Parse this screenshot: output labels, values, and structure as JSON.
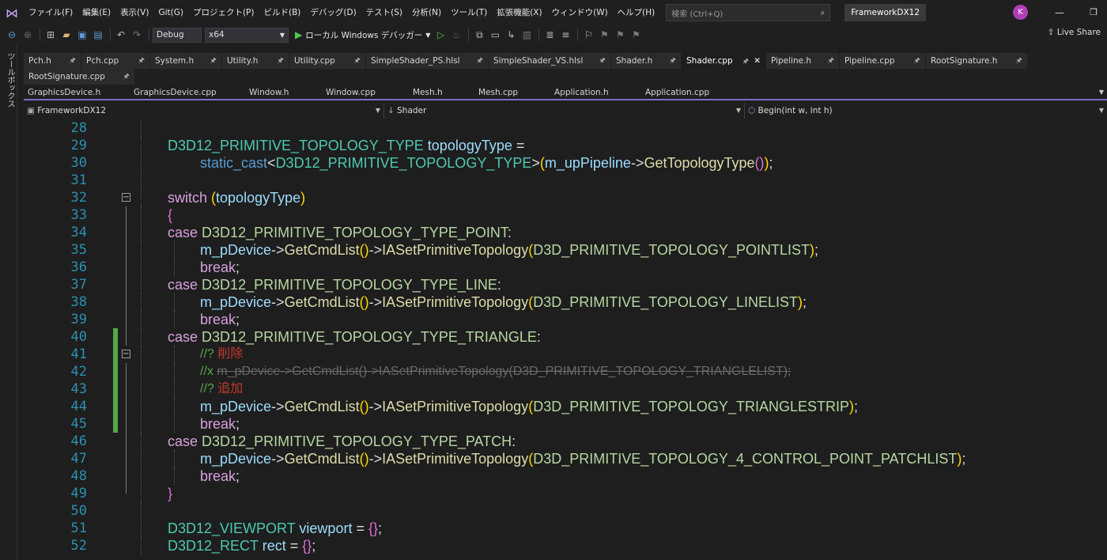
{
  "menubar": {
    "items": [
      "ファイル(F)",
      "編集(E)",
      "表示(V)",
      "Git(G)",
      "プロジェクト(P)",
      "ビルド(B)",
      "デバッグ(D)",
      "テスト(S)",
      "分析(N)",
      "ツール(T)",
      "拡張機能(X)",
      "ウィンドウ(W)",
      "ヘルプ(H)"
    ],
    "search_placeholder": "検索 (Ctrl+Q)",
    "solution_name": "FrameworkDX12",
    "avatar_initial": "K"
  },
  "toolbar": {
    "configuration": "Debug",
    "platform": "x64",
    "run_label": "ローカル Windows デバッガー",
    "live_share": "Live Share"
  },
  "toolbox": {
    "label": "ツールボックス"
  },
  "tabs_row1": [
    {
      "label": "Pch.h",
      "active": false
    },
    {
      "label": "Pch.cpp",
      "active": false
    },
    {
      "label": "System.h",
      "active": false
    },
    {
      "label": "Utility.h",
      "active": false
    },
    {
      "label": "Utility.cpp",
      "active": false
    },
    {
      "label": "SimpleShader_PS.hlsl",
      "active": false
    },
    {
      "label": "SimpleShader_VS.hlsl",
      "active": false
    },
    {
      "label": "Shader.h",
      "active": false
    },
    {
      "label": "Shader.cpp",
      "active": true
    },
    {
      "label": "Pipeline.h",
      "active": false
    },
    {
      "label": "Pipeline.cpp",
      "active": false
    },
    {
      "label": "RootSignature.h",
      "active": false
    }
  ],
  "tabs_row2": [
    {
      "label": "RootSignature.cpp",
      "active": false
    }
  ],
  "tabs_row3": [
    "GraphicsDevice.h",
    "GraphicsDevice.cpp",
    "Window.h",
    "Window.cpp",
    "Mesh.h",
    "Mesh.cpp",
    "Application.h",
    "Application.cpp"
  ],
  "navbar": {
    "project": "FrameworkDX12",
    "scope": "Shader",
    "member": "Begin(int w, int h)"
  },
  "editor": {
    "line_numbers": [
      "28",
      "29",
      "30",
      "31",
      "32",
      "33",
      "34",
      "35",
      "36",
      "37",
      "38",
      "39",
      "40",
      "41",
      "42",
      "43",
      "44",
      "45",
      "46",
      "47",
      "48",
      "49",
      "50",
      "51",
      "52"
    ],
    "code": {
      "l29_type": "D3D12_PRIMITIVE_TOPOLOGY_TYPE",
      "l29_var": "topologyType",
      "l30_cast": "static_cast",
      "l30_type": "D3D12_PRIMITIVE_TOPOLOGY_TYPE",
      "l30_member": "m_upPipeline",
      "l30_fn": "GetTopologyType",
      "l32_switch": "switch",
      "l32_var": "topologyType",
      "case": "case",
      "break": "break",
      "l34_enum": "D3D12_PRIMITIVE_TOPOLOGY_TYPE_POINT",
      "device": "m_pDevice",
      "get_cmd": "GetCmdList",
      "set_topo": "IASetPrimitiveTopology",
      "l35_arg": "D3D_PRIMITIVE_TOPOLOGY_POINTLIST",
      "l37_enum": "D3D12_PRIMITIVE_TOPOLOGY_TYPE_LINE",
      "l38_arg": "D3D_PRIMITIVE_TOPOLOGY_LINELIST",
      "l40_enum": "D3D12_PRIMITIVE_TOPOLOGY_TYPE_TRIANGLE",
      "l41_comment": "//? ",
      "l41_note": "削除",
      "l42_prefix": "//x ",
      "l42_struck": "m_pDevice->GetCmdList()->IASetPrimitiveTopology(D3D_PRIMITIVE_TOPOLOGY_TRIANGLELIST);",
      "l43_comment": "//? ",
      "l43_note": "追加",
      "l44_arg": "D3D_PRIMITIVE_TOPOLOGY_TRIANGLESTRIP",
      "l46_enum": "D3D12_PRIMITIVE_TOPOLOGY_TYPE_PATCH",
      "l47_arg": "D3D_PRIMITIVE_TOPOLOGY_4_CONTROL_POINT_PATCHLIST",
      "l51_type": "D3D12_VIEWPORT",
      "l51_var": "viewport",
      "l52_type": "D3D12_RECT",
      "l52_var": "rect"
    }
  },
  "colors": {
    "accent": "#7d6bc9",
    "line_number": "#2b91af",
    "keyword": "#569cd6",
    "control": "#d8a0df",
    "enum": "#b8d7a3",
    "function": "#dcdcaa",
    "change_bar": "#57a64a"
  }
}
